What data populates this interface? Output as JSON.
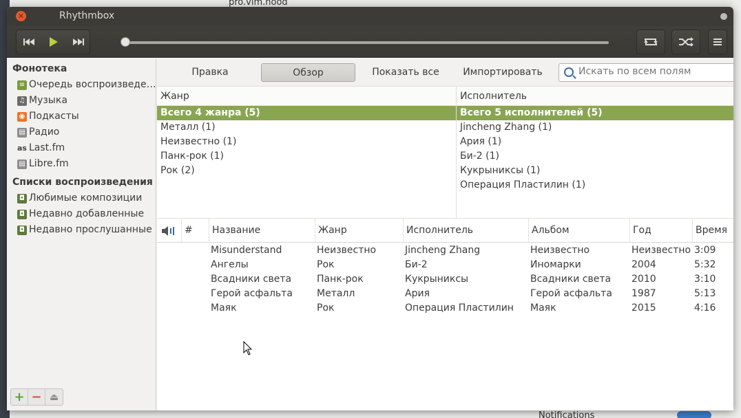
{
  "window": {
    "title": "Rhythmbox"
  },
  "background": {
    "top_text": "pro.vim.hood",
    "notifications_label": "Notifications"
  },
  "toolbar": {
    "prev_icon": "skip-back-icon",
    "play_icon": "play-icon",
    "next_icon": "skip-forward-icon",
    "repeat_icon": "repeat-icon",
    "shuffle_icon": "shuffle-icon",
    "menu_icon": "hamburger-menu-icon",
    "progress": 0,
    "accent": "#b6d144"
  },
  "sidebar": {
    "library_header": "Фонотека",
    "library_items": [
      {
        "label": "Очередь воспроизведе…",
        "icon": "queue-icon",
        "color": "#7a9a3a"
      },
      {
        "label": "Музыка",
        "icon": "music-icon",
        "color": "#6b6b6b"
      },
      {
        "label": "Подкасты",
        "icon": "podcast-icon",
        "color": "#e8762b"
      },
      {
        "label": "Радио",
        "icon": "radio-icon",
        "color": "#8c8c8c"
      },
      {
        "label": "Last.fm",
        "icon": "lastfm-icon",
        "color": "#555555"
      },
      {
        "label": "Libre.fm",
        "icon": "librefm-icon",
        "color": "#8c8c8c"
      }
    ],
    "playlists_header": "Списки воспроизведения",
    "playlist_items": [
      {
        "label": "Любимые композиции",
        "icon": "auto-playlist-icon"
      },
      {
        "label": "Недавно добавленные",
        "icon": "auto-playlist-icon"
      },
      {
        "label": "Недавно прослушанные",
        "icon": "auto-playlist-icon"
      }
    ],
    "bottom_buttons": [
      {
        "label": "+",
        "icon": "add-icon",
        "color": "#5ca533"
      },
      {
        "label": "−",
        "icon": "remove-icon",
        "color": "#d24b4b"
      },
      {
        "label": "⏏",
        "icon": "eject-icon",
        "color": "#8a8a8a"
      }
    ]
  },
  "browse_bar": {
    "edit_label": "Правка",
    "browse_label": "Обзор",
    "show_all_label": "Показать все",
    "import_label": "Импортировать",
    "search_placeholder": "Искать по всем полям"
  },
  "genre_pane": {
    "header": "Жанр",
    "rows": [
      "Всего 4 жанра (5)",
      "Металл (1)",
      "Неизвестно (1)",
      "Панк-рок (1)",
      "Рок (2)"
    ],
    "selected_index": 0
  },
  "artist_pane": {
    "header": "Исполнитель",
    "rows": [
      "Всего 5 исполнителей (5)",
      "Jincheng Zhang (1)",
      "Ария (1)",
      "Би-2 (1)",
      "Кукрыниксы (1)",
      "Операция Пластилин (1)"
    ],
    "selected_index": 0
  },
  "tracks": {
    "columns": [
      "#",
      "Название",
      "Жанр",
      "Исполнитель",
      "Альбом",
      "Год",
      "Время"
    ],
    "rows": [
      [
        "",
        "Misunderstand",
        "Неизвестно",
        "Jincheng Zhang",
        "Неизвестно",
        "Неизвестно",
        "3:09"
      ],
      [
        "",
        "Ангелы",
        "Рок",
        "Би-2",
        "Иномарки",
        "2004",
        "5:32"
      ],
      [
        "",
        "Всадники света",
        "Панк-рок",
        "Кукрыниксы",
        "Всадники света",
        "2010",
        "3:10"
      ],
      [
        "",
        "Герой асфальта",
        "Металл",
        "Ария",
        "Герой асфальта",
        "1987",
        "5:13"
      ],
      [
        "",
        "Маяк",
        "Рок",
        "Операция Пластилин",
        "Маяк",
        "2015",
        "4:16"
      ]
    ]
  },
  "selection_color": "#8aa550"
}
